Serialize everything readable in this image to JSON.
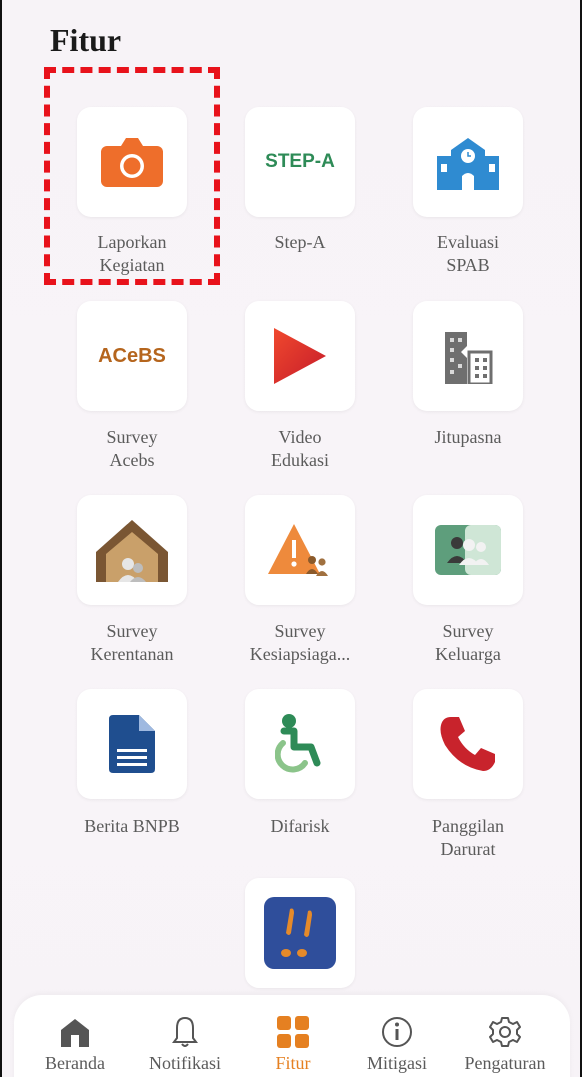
{
  "header": {
    "title": "Fitur"
  },
  "features": [
    {
      "label": "Laporkan\nKegiatan",
      "icon": "camera-icon"
    },
    {
      "label": "Step-A",
      "icon": "step-a-logo-icon",
      "icon_text": "STEP-A"
    },
    {
      "label": "Evaluasi\nSPAB",
      "icon": "school-building-icon"
    },
    {
      "label": "Survey\nAcebs",
      "icon": "acebs-logo-icon",
      "icon_text": "ACeBS"
    },
    {
      "label": "Video\nEdukasi",
      "icon": "play-icon"
    },
    {
      "label": "Jitupasna",
      "icon": "damaged-building-icon"
    },
    {
      "label": "Survey\nKerentanan",
      "icon": "house-people-icon"
    },
    {
      "label": "Survey\nKesiapsiaga...",
      "icon": "warning-people-icon"
    },
    {
      "label": "Survey\nKeluarga",
      "icon": "family-icon"
    },
    {
      "label": "Berita BNPB",
      "icon": "document-icon"
    },
    {
      "label": "Difarisk",
      "icon": "wheelchair-icon"
    },
    {
      "label": "Panggilan\nDarurat",
      "icon": "phone-icon"
    },
    {
      "label": "",
      "icon": "footprints-icon"
    }
  ],
  "bottom_nav": [
    {
      "label": "Beranda",
      "icon": "home-icon"
    },
    {
      "label": "Notifikasi",
      "icon": "bell-icon"
    },
    {
      "label": "Fitur",
      "icon": "grid-icon",
      "active": true
    },
    {
      "label": "Mitigasi",
      "icon": "info-icon"
    },
    {
      "label": "Pengaturan",
      "icon": "gear-icon"
    }
  ],
  "colors": {
    "accent": "#e58021",
    "highlight": "#e8121b"
  }
}
